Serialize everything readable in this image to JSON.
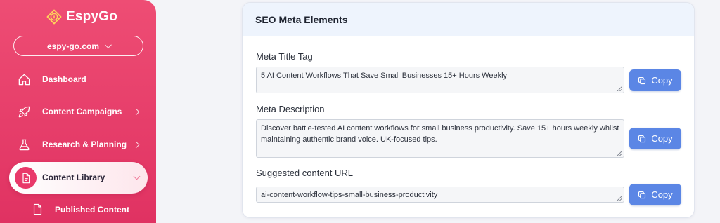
{
  "sidebar": {
    "logo": {
      "text": "EspyGo",
      "icon": "compass-diamond-icon"
    },
    "site_selector": {
      "value": "espy-go.com",
      "icon": "chevron-down-icon"
    },
    "items": [
      {
        "label": "Dashboard",
        "icon": "home-icon"
      },
      {
        "label": "Content Campaigns",
        "icon": "rocket-icon"
      },
      {
        "label": "Research & Planning",
        "icon": "flask-icon"
      },
      {
        "label": "Content Library",
        "icon": "document-icon",
        "active": true
      },
      {
        "label": "Published Content",
        "icon": "file-icon"
      }
    ]
  },
  "card": {
    "title": "SEO Meta Elements",
    "fields": [
      {
        "label": "Meta Title Tag",
        "value": "5 AI Content Workflows That Save Small Businesses 15+ Hours Weekly",
        "copy_label": "Copy"
      },
      {
        "label": "Meta Description",
        "value": "Discover battle-tested AI content workflows for small business productivity. Save 15+ hours weekly whilst maintaining authentic brand voice. UK-focused tips.",
        "copy_label": "Copy"
      },
      {
        "label": "Suggested content URL",
        "value": "ai-content-workflow-tips-small-business-productivity",
        "copy_label": "Copy"
      }
    ]
  },
  "colors": {
    "sidebar_top": "#ee4d74",
    "sidebar_bottom": "#e03262",
    "accent_button": "#5b86e5",
    "card_header_bg": "#eef4fd"
  }
}
